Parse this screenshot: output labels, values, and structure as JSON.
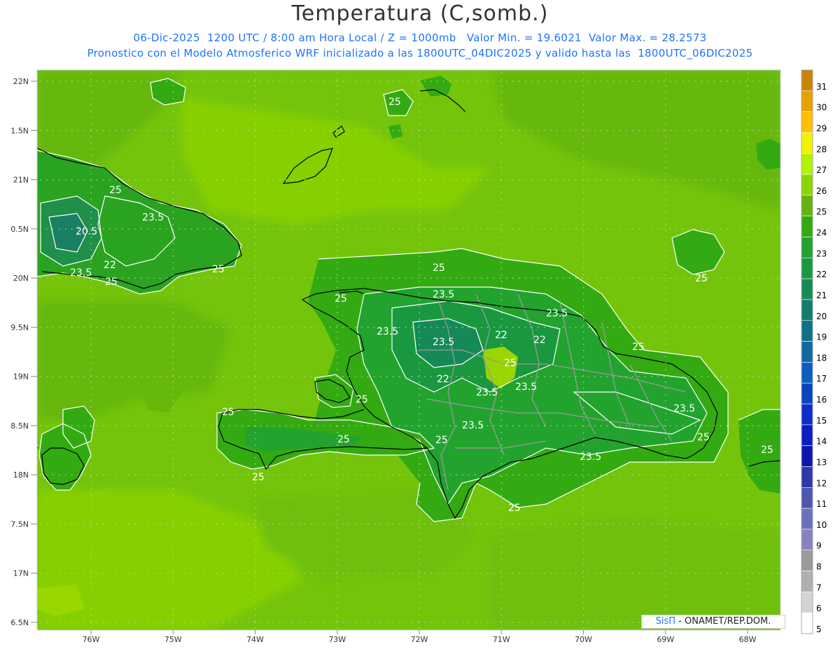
{
  "title": "Temperatura (C,somb.)",
  "subtitle_line1": "06-Dic-2025  1200 UTC / 8:00 am Hora Local / Z = 1000mb   Valor Min. = 19.6021  Valor Max. = 28.2573",
  "subtitle_line2": "Pronostico con el Modelo Atmosferico WRF inicializado a las 1800UTC_04DIC2025 y valido hasta las  1800UTC_06DIC2025",
  "lat_labels": [
    "22N",
    "1.5N",
    "21N",
    "0.5N",
    "20N",
    "9.5N",
    "19N",
    "8.5N",
    "18N",
    "7.5N",
    "17N",
    "6.5N"
  ],
  "lat_values": [
    22,
    21.5,
    21,
    20.5,
    20,
    19.5,
    19,
    18.5,
    18,
    17.5,
    17,
    16.5
  ],
  "lon_labels": [
    "76W",
    "75W",
    "74W",
    "73W",
    "72W",
    "71W",
    "70W",
    "69W",
    "68W"
  ],
  "lon_values": [
    -76,
    -75,
    -74,
    -73,
    -72,
    -71,
    -70,
    -69,
    -68
  ],
  "colorbar": {
    "levels": [
      "31",
      "30",
      "29",
      "28",
      "27",
      "26",
      "25",
      "24",
      "23",
      "22",
      "21",
      "20",
      "19",
      "18",
      "17",
      "16",
      "15",
      "14",
      "13",
      "12",
      "11",
      "10",
      "9",
      "8",
      "7",
      "6",
      "5"
    ],
    "colors": [
      "#c98406",
      "#e6a300",
      "#ffc000",
      "#f2f200",
      "#b3f200",
      "#8cd600",
      "#66b30d",
      "#33aa11",
      "#22a32e",
      "#1a9840",
      "#158a57",
      "#137c6e",
      "#107085",
      "#0f6aa0",
      "#0d5cc2",
      "#0a44c0",
      "#0a30c8",
      "#0a1ec4",
      "#0f14b0",
      "#2e3aa8",
      "#4d56b0",
      "#6a70ba",
      "#8a82c0",
      "#9a9a9a",
      "#b0b0b0",
      "#d4d4d4",
      "#ffffff"
    ]
  },
  "contour_labels": [
    "25",
    "23.5",
    "22",
    "20.5"
  ],
  "credit": {
    "brand": "SisΠ",
    "text": " - ONAMET/REP.DOM."
  }
}
